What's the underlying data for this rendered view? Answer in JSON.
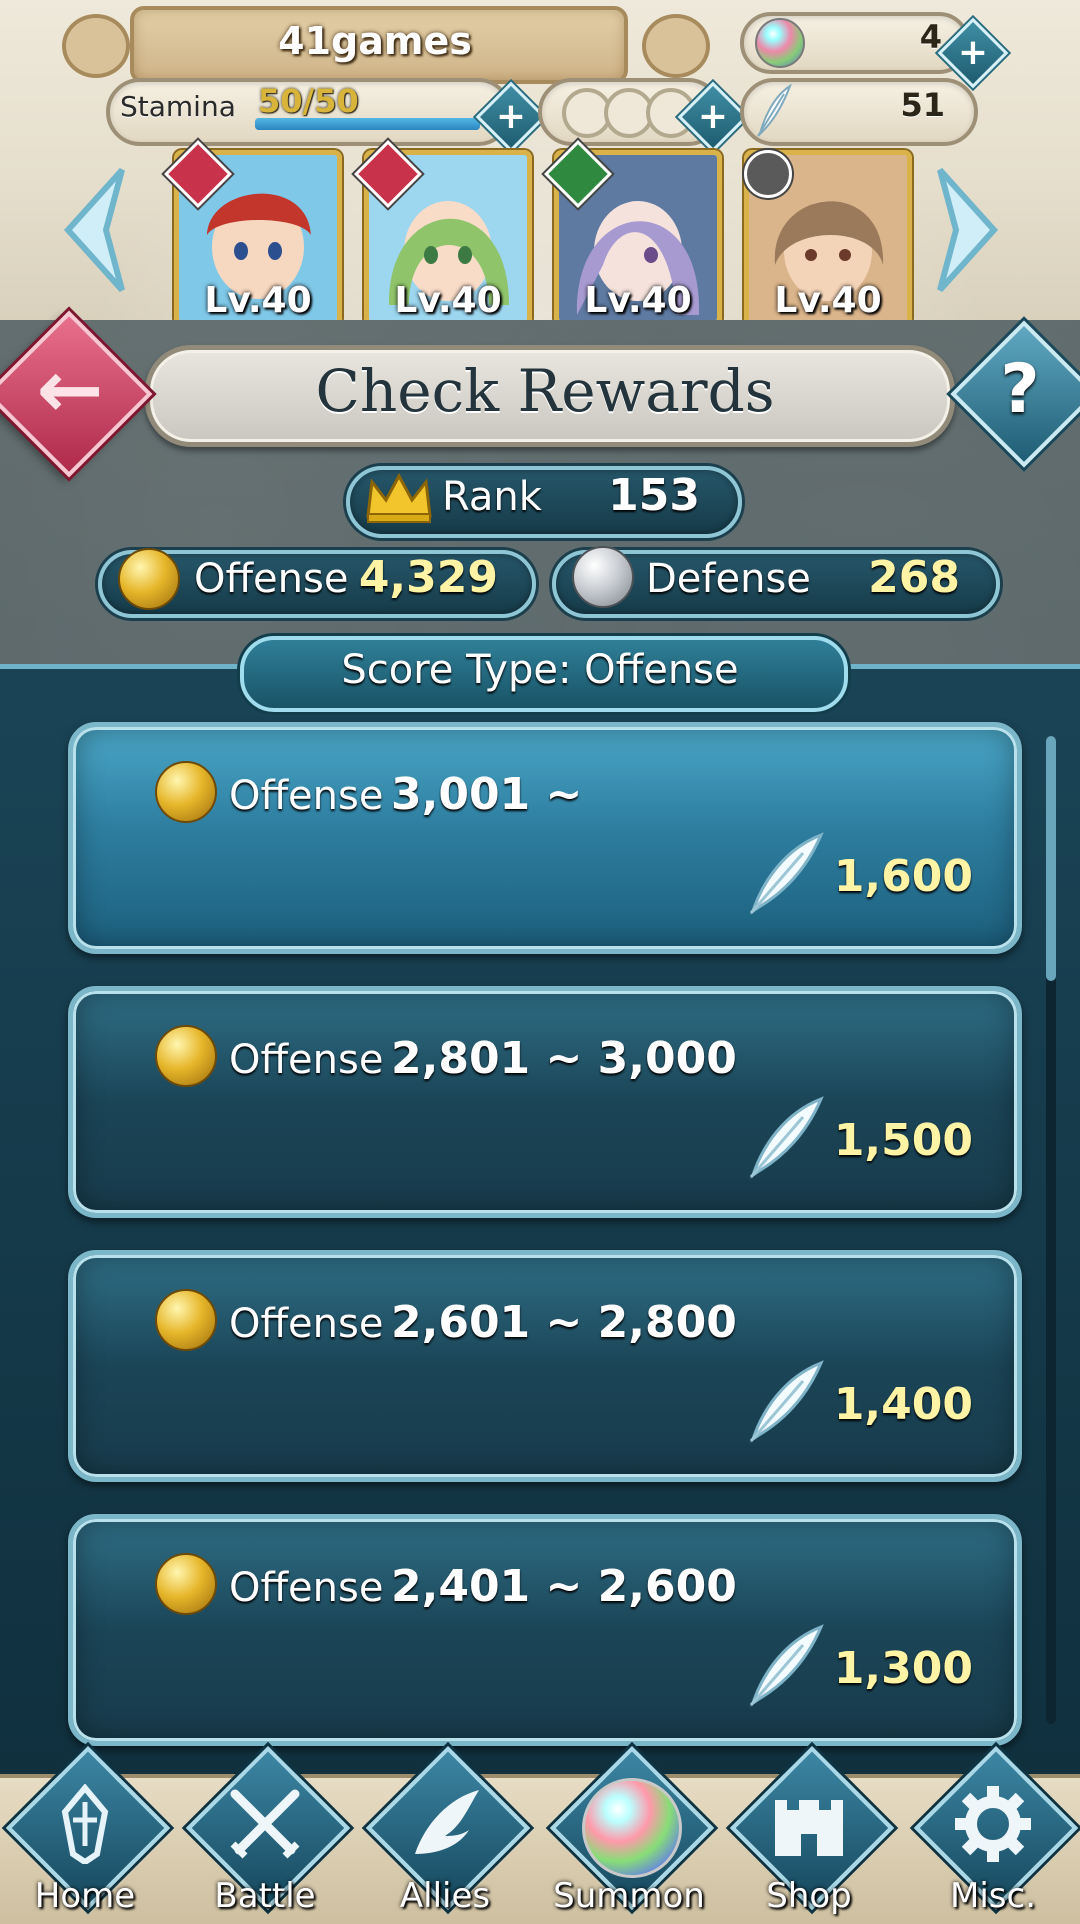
{
  "header": {
    "games_label": "41games",
    "orbs_count": "4",
    "stamina_label": "Stamina",
    "stamina_value": "50/50",
    "stamina_fraction": 1.0,
    "feathers_count": "51",
    "heroes": [
      {
        "level": "Lv.40",
        "badge_color": "#c8324a",
        "icon": "sword-badge-icon",
        "hair": "#c2362b",
        "bg": "#7fc8e8"
      },
      {
        "level": "Lv.40",
        "badge_color": "#c8324a",
        "icon": "fire-tome-badge-icon",
        "hair": "#8fc46a",
        "bg": "#9cd6ef"
      },
      {
        "level": "Lv.40",
        "badge_color": "#2f8a3f",
        "icon": "axe-badge-icon",
        "hair": "#a79ad1",
        "bg": "#5e7aa1"
      },
      {
        "level": "Lv.40",
        "badge_color": "#5a5a5a",
        "icon": "bow-badge-icon",
        "hair": "#9b7a5b",
        "bg": "#dab48a"
      }
    ]
  },
  "title": {
    "text": "Check Rewards"
  },
  "rank": {
    "label": "Rank",
    "value": "153"
  },
  "scores": {
    "offense_label": "Offense",
    "offense_value": "4,329",
    "defense_label": "Defense",
    "defense_value": "268"
  },
  "score_type": {
    "text": "Score Type: Offense"
  },
  "rewards": [
    {
      "label": "Offense",
      "range": "3,001 ~",
      "reward": "1,600",
      "selected": true
    },
    {
      "label": "Offense",
      "range": "2,801 ~ 3,000",
      "reward": "1,500",
      "selected": false
    },
    {
      "label": "Offense",
      "range": "2,601 ~ 2,800",
      "reward": "1,400",
      "selected": false
    },
    {
      "label": "Offense",
      "range": "2,401 ~ 2,600",
      "reward": "1,300",
      "selected": false
    }
  ],
  "nav": [
    {
      "label": "Home",
      "icon": "home-crest-icon"
    },
    {
      "label": "Battle",
      "icon": "crossed-swords-icon"
    },
    {
      "label": "Allies",
      "icon": "wing-icon"
    },
    {
      "label": "Summon",
      "icon": "orb-icon"
    },
    {
      "label": "Shop",
      "icon": "castle-icon"
    },
    {
      "label": "Misc.",
      "icon": "gear-icon"
    }
  ],
  "colors": {
    "accent_teal": "#2e7ea0",
    "value_yellow": "#fff3a6",
    "back_button_pink": "#b02a4b"
  }
}
